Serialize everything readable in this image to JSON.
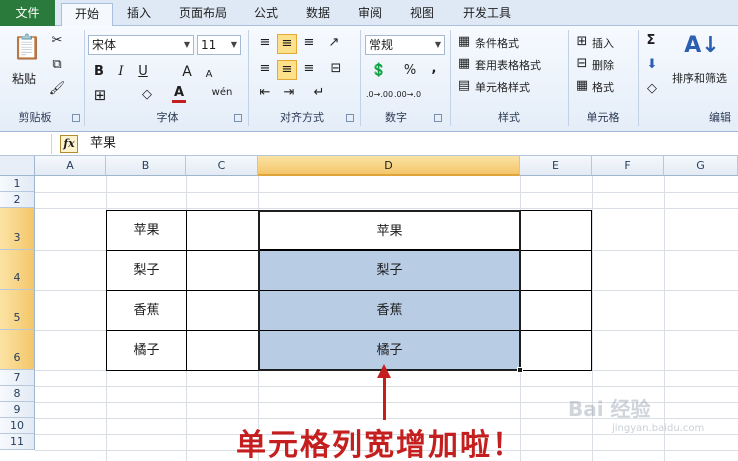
{
  "tabs": [
    "文件",
    "开始",
    "插入",
    "页面布局",
    "公式",
    "数据",
    "审阅",
    "视图",
    "开发工具"
  ],
  "ribbon": {
    "clipboard": {
      "paste": "粘贴",
      "label": "剪贴板"
    },
    "font": {
      "name": "宋体",
      "size": "11",
      "label": "字体",
      "bold": "B",
      "italic": "I",
      "underline": "U",
      "grow": "A",
      "shrink": "A",
      "color_a": "A",
      "wen": "wén"
    },
    "align": {
      "label": "对齐方式"
    },
    "number": {
      "format": "常规",
      "label": "数字",
      "percent": "%",
      "comma": ",",
      "inc": ".0→.00",
      "dec": ".00→.0"
    },
    "styles": {
      "cond": "条件格式",
      "table": "套用表格格式",
      "cell": "单元格样式",
      "label": "样式"
    },
    "cells": {
      "insert": "插入",
      "delete": "删除",
      "format": "格式",
      "label": "单元格"
    },
    "edit": {
      "sigma": "Σ",
      "sort": "排序和筛选",
      "label": "编辑"
    }
  },
  "formula_bar": {
    "fx": "fx",
    "content": "苹果"
  },
  "columns": [
    "A",
    "B",
    "C",
    "D",
    "E",
    "F",
    "G"
  ],
  "rows": [
    "1",
    "2",
    "3",
    "4",
    "5",
    "6",
    "7",
    "8",
    "9",
    "10",
    "11"
  ],
  "cells": {
    "b3": "苹果",
    "b4": "梨子",
    "b5": "香蕉",
    "b6": "橘子",
    "d3": "苹果",
    "d4": "梨子",
    "d5": "香蕉",
    "d6": "橘子"
  },
  "annotation": "单元格列宽增加啦！",
  "watermark": "Bai 经验",
  "watermark_url": "jingyan.baidu.com",
  "colors": {
    "accent": "#c51e1e",
    "selection": "#b8cce4",
    "file_tab": "#2a7a3b"
  }
}
